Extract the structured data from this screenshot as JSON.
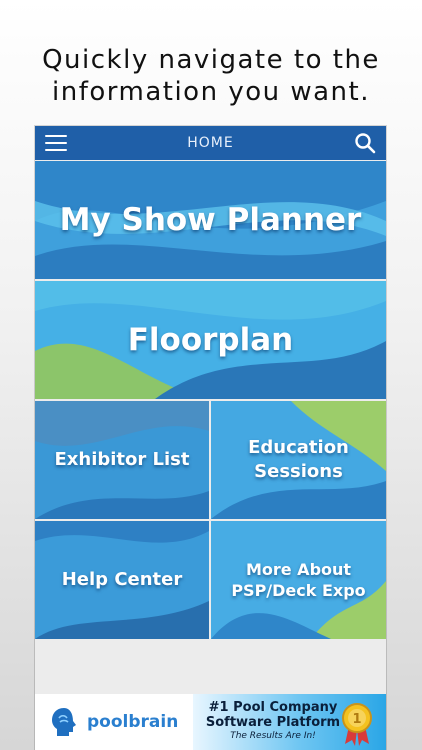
{
  "headline": "Quickly navigate to the\ninformation you want.",
  "navbar": {
    "title": "HOME",
    "menu_icon": "hamburger-menu-icon",
    "search_icon": "search-icon",
    "color": "#1f5fa8"
  },
  "tiles": [
    {
      "label": "My Show Planner"
    },
    {
      "label": "Floorplan"
    },
    {
      "label": "Exhibitor List"
    },
    {
      "label": "Education\nSessions"
    },
    {
      "label": "Help Center"
    },
    {
      "label": "More About\nPSP/Deck Expo"
    }
  ],
  "banner": {
    "brand": "poolbrain",
    "tagline_1": "#1 Pool Company",
    "tagline_2": "Software Platform",
    "tagline_3": "The Results Are In!",
    "brand_color": "#2a7fcf"
  }
}
